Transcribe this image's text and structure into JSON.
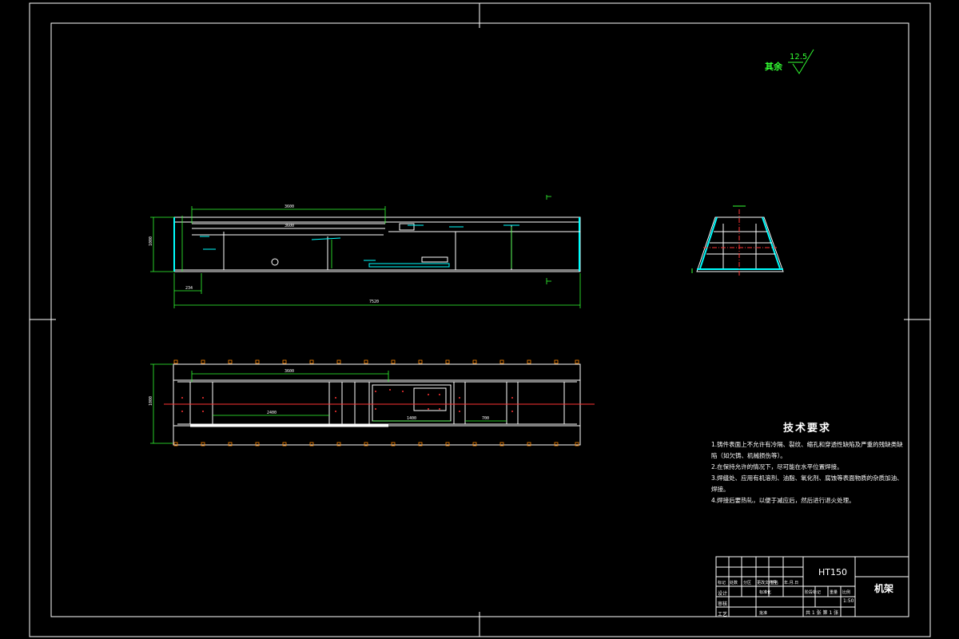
{
  "roughness": {
    "label": "其余",
    "value": "12.5"
  },
  "technical_requirements": {
    "title": "技术要求",
    "items": [
      "1.铸件表面上不允许有冷隔、裂纹、缩孔和穿透性缺陷及严重的残缺类缺陷（如欠铸、机械损伤等）。",
      "2.在保持允许的情况下，尽可能在水平位置焊接。",
      "3.焊缝处、应用有机溶剂、油脂、氧化剂、腐蚀等表面物质的杂质加油、焊接。",
      "4.焊接后要热轧，以便于减应后，然后进行退火处理。"
    ]
  },
  "title_block": {
    "material": "HT150",
    "part_name": "机架",
    "scale": "1:50",
    "sheet_info": "共 1 张  第 1 张",
    "headers": [
      "标记",
      "处数",
      "分区",
      "更改文件号",
      "签名",
      "年.月.日"
    ],
    "roles": [
      "设计",
      "审核",
      "工艺"
    ],
    "misc": [
      "标准化",
      "批准",
      "阶段标记",
      "重量",
      "比例"
    ]
  },
  "dimensions": {
    "overall_length": "7520",
    "overall_height": "1000",
    "left_offset": "234",
    "top_span": "3600",
    "inner_span": "3600",
    "plan_width": "1000",
    "plan_span_1": "3600",
    "plan_span_2": "2400",
    "plan_span_3": "1400",
    "plan_span_4": "700"
  }
}
